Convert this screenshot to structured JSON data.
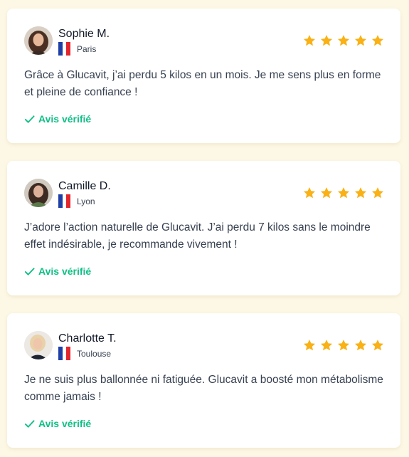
{
  "accent_color": "#10bf86",
  "star_color": "#f9b115",
  "reviews": [
    {
      "name": "Sophie M.",
      "city": "Paris",
      "flag": "france-flag-icon",
      "rating": 5,
      "text": "Grâce à Glucavit, j’ai perdu 5 kilos en un mois. Je me sens plus en forme et pleine de confiance !",
      "verified_label": "Avis vérifié"
    },
    {
      "name": "Camille D.",
      "city": "Lyon",
      "flag": "france-flag-icon",
      "rating": 5,
      "text": "J’adore l’action naturelle de Glucavit. J’ai perdu 7 kilos sans le moindre effet indésirable, je recommande vivement !",
      "verified_label": "Avis vérifié"
    },
    {
      "name": "Charlotte T.",
      "city": "Toulouse",
      "flag": "france-flag-icon",
      "rating": 5,
      "text": "Je ne suis plus ballonnée ni fatiguée. Glucavit a boosté mon métabolisme comme jamais !",
      "verified_label": "Avis vérifié"
    }
  ]
}
